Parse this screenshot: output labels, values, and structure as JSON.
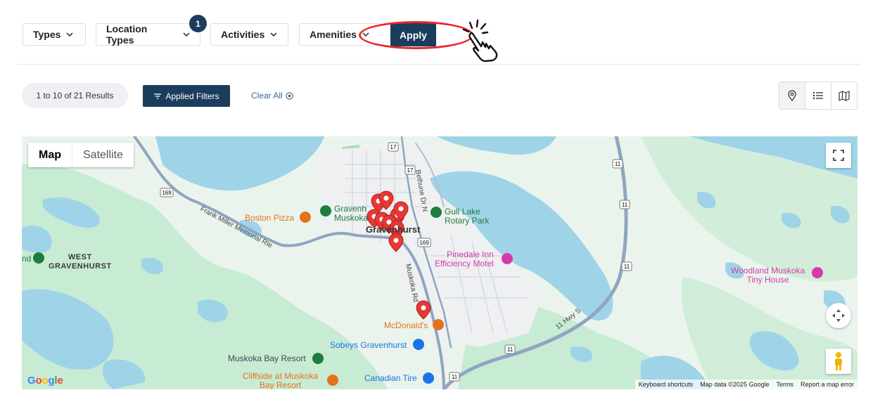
{
  "filters": {
    "types_label": "Types",
    "location_types_label": "Location Types",
    "location_types_badge": "1",
    "activities_label": "Activities",
    "amenities_label": "Amenities",
    "apply_label": "Apply"
  },
  "results": {
    "count_text": "1 to 10 of 21 Results",
    "applied_filters_label": "Applied Filters",
    "clear_all_label": "Clear All"
  },
  "view_modes": [
    "location-pin",
    "list",
    "map"
  ],
  "map": {
    "map_type_active": "Map",
    "map_type_other": "Satellite",
    "labels": {
      "boston_pizza": "Boston Pizza",
      "gravenhurst_muskoka": "Gravenhurst Muskoka",
      "gravenhurst_muskoka_line1": "Gravenh",
      "gravenhurst_muskoka_line2": "Muskoka",
      "gravenhurst": "Gravenhurst",
      "gull_lake_line1": "Gull Lake",
      "gull_lake_line2": "Rotary Park",
      "pinedale_line1": "Pinedale Inn",
      "pinedale_line2": "Efficiency Motel",
      "woodland_line1": "Woodland Muskoka",
      "woodland_line2": "Tiny House",
      "west_gravenhurst_line1": "WEST",
      "west_gravenhurst_line2": "GRAVENHURST",
      "mcdonalds": "McDonald's",
      "sobeys": "Sobeys Gravenhurst",
      "muskoka_bay_resort": "Muskoka Bay Resort",
      "cliffside_line1": "Cliffside at Muskoka",
      "cliffside_line2": "Bay Resort",
      "canadian_tire": "Canadian Tire",
      "frank_miller": "Frank Miller Memorial Rte",
      "bethune": "Bethune Dr N",
      "muskoka_rd": "Muskoka Rd",
      "hwy_s": "11 Hwy S",
      "route_169": "169",
      "route_11": "11",
      "route_17": "17",
      "nd": "nd"
    },
    "attribution": {
      "keyboard": "Keyboard shortcuts",
      "map_data": "Map data ©2025 Google",
      "terms": "Terms",
      "report": "Report a map error"
    },
    "google_logo": "Google",
    "marker_count": 10
  },
  "colors": {
    "primary": "#1b3d5d",
    "marker": "#e53935",
    "annotation": "#e8262c",
    "land": "#eaf4ec",
    "park": "#c8ebd3",
    "water": "#9fd4e8",
    "road_major": "#8fa5c0"
  }
}
